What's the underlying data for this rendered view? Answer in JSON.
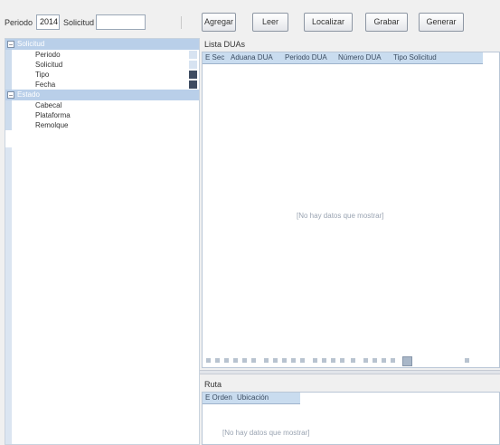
{
  "toolbar": {
    "periodo_label": "Periodo",
    "periodo_value": "2014",
    "solicitud_label": "Solicitud",
    "solicitud_value": "",
    "buttons": [
      "Agregar",
      "Leer",
      "Localizar",
      "Grabar",
      "Generar"
    ]
  },
  "tree": {
    "groups": [
      {
        "label": "Solicitud",
        "toggle": "−",
        "items": [
          {
            "label": "Periodo",
            "button": "plain"
          },
          {
            "label": "Solicitud",
            "button": "plain"
          },
          {
            "label": "Tipo",
            "button": "dropdown"
          },
          {
            "label": "Fecha",
            "button": "dropdown"
          }
        ]
      },
      {
        "label": "Estado",
        "toggle": "−",
        "items": [
          {
            "label": "Cabecal"
          },
          {
            "label": "Plataforma"
          },
          {
            "label": "Remolque"
          }
        ]
      }
    ]
  },
  "lista": {
    "title": "Lista DUAs",
    "columns": [
      "E Sec",
      "Aduana DUA",
      "Periodo DUA",
      "Número DUA",
      "Tipo Solicitud"
    ],
    "empty_message": "[No hay datos que mostrar]"
  },
  "ruta": {
    "title": "Ruta",
    "columns": [
      "E Orden",
      "Ubicación"
    ],
    "empty_message": "[No hay datos que mostrar]"
  },
  "colors": {
    "grid_header": "#c9dcef",
    "tree_group": "#b9cfe9",
    "window_bg": "#f0f0f0"
  }
}
